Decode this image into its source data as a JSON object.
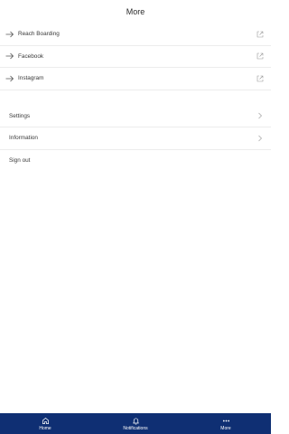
{
  "header": {
    "title": "More"
  },
  "links": [
    {
      "label": "Reach Boarding"
    },
    {
      "label": "Facebook"
    },
    {
      "label": "Instagram"
    }
  ],
  "menu": [
    {
      "label": "Settings"
    },
    {
      "label": "Information"
    }
  ],
  "signout": {
    "label": "Sign out"
  },
  "tabbar": {
    "tabs": [
      {
        "label": "Home",
        "icon": "home-icon"
      },
      {
        "label": "Notifications",
        "icon": "bell-icon"
      },
      {
        "label": "More",
        "icon": "more-dots-icon"
      }
    ],
    "active": "More",
    "background": "#0f2f73"
  }
}
